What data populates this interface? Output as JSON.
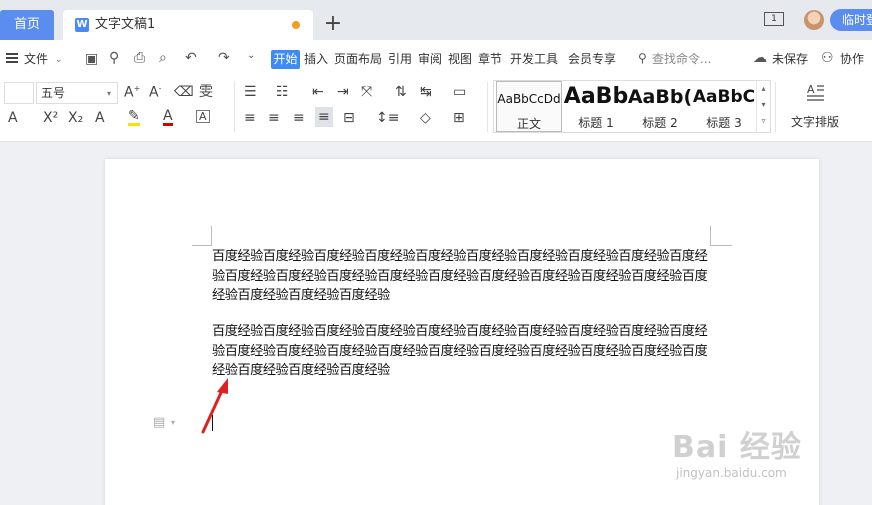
{
  "tabs": {
    "home": "首页",
    "doc_title": "文字文稿1",
    "new_tab": "+"
  },
  "window": {
    "number": "1",
    "temp_button": "临时登"
  },
  "menu": {
    "file": "文件",
    "items": [
      "开始",
      "插入",
      "页面布局",
      "引用",
      "审阅",
      "视图",
      "章节",
      "开发工具",
      "会员专享"
    ],
    "search_placeholder": "查找命令...",
    "unsaved": "未保存",
    "collaborate": "协作"
  },
  "ribbon": {
    "font_size": "五号",
    "styles": [
      {
        "sample": "AaBbCcDd",
        "name": "正文"
      },
      {
        "sample": "AaBb",
        "name": "标题 1"
      },
      {
        "sample": "AaBb(",
        "name": "标题 2"
      },
      {
        "sample": "AaBbC",
        "name": "标题 3"
      }
    ],
    "text_layout": "文字排版"
  },
  "document": {
    "paragraphs": [
      "百度经验百度经验百度经验百度经验百度经验百度经验百度经验百度经验百度经验百度经验百度经验百度经验百度经验百度经验百度经验百度经验百度经验百度经验百度经验百度经验百度经验百度经验百度经验",
      "百度经验百度经验百度经验百度经验百度经验百度经验百度经验百度经验百度经验百度经验百度经验百度经验百度经验百度经验百度经验百度经验百度经验百度经验百度经验百度经验百度经验百度经验百度经验"
    ]
  },
  "watermark": {
    "logo": "Bai 经验",
    "url": "jingyan.baidu.com"
  },
  "colors": {
    "accent": "#3f8bf5",
    "home_tab": "#5b8def",
    "unsaved_dot": "#f0a020",
    "arrow": "#e02020"
  }
}
